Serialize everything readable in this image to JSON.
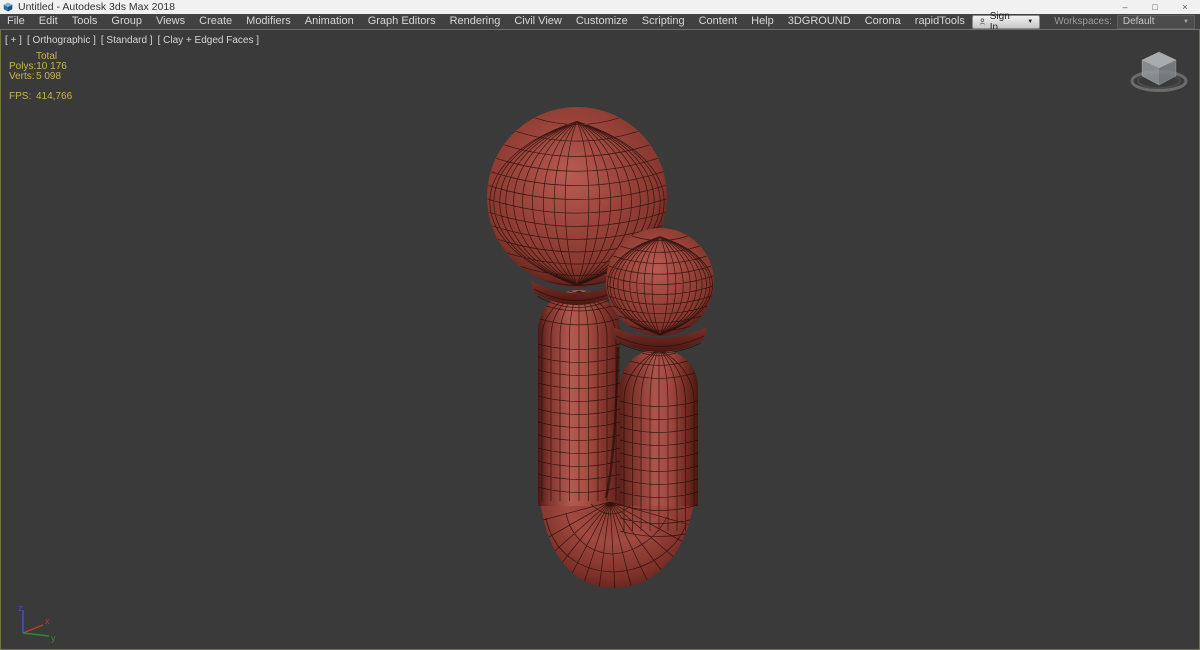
{
  "window": {
    "title": "Untitled - Autodesk 3ds Max 2018",
    "minimize": "–",
    "restore": "□",
    "close": "×"
  },
  "menubar": {
    "items": [
      "File",
      "Edit",
      "Tools",
      "Group",
      "Views",
      "Create",
      "Modifiers",
      "Animation",
      "Graph Editors",
      "Rendering",
      "Civil View",
      "Customize",
      "Scripting",
      "Content",
      "Help",
      "3DGROUND",
      "Corona",
      "rapidTools"
    ],
    "sign_in_label": "Sign In",
    "workspaces_label": "Workspaces:",
    "workspaces_value": "Default"
  },
  "viewport": {
    "labels": {
      "menu": "[ + ]",
      "view": "[ Orthographic ]",
      "shading": "[ Standard ]",
      "style": "[ Clay + Edged Faces ]"
    },
    "stats": {
      "total_header": "Total",
      "polys_label": "Polys:",
      "polys_value": "10 176",
      "verts_label": "Verts:",
      "verts_value": "5 098",
      "fps_label": "FPS:",
      "fps_value": "414,766"
    },
    "axis": {
      "x": "x",
      "y": "y",
      "z": "z"
    }
  },
  "scene": {
    "colors": {
      "viewport_bg": "#3a3a3a",
      "viewport_border": "#75743e",
      "stats_text": "#c8b44f",
      "clay_light": "#b85c51",
      "clay_mid": "#9a443b",
      "clay_dark": "#5c211b",
      "clay_deep": "#4a1712",
      "wire": "#200c08",
      "axis_x": "#c0392f",
      "axis_y": "#2e8b2e",
      "axis_z": "#3a50c8",
      "viewcube": "#a9aeb0"
    }
  }
}
